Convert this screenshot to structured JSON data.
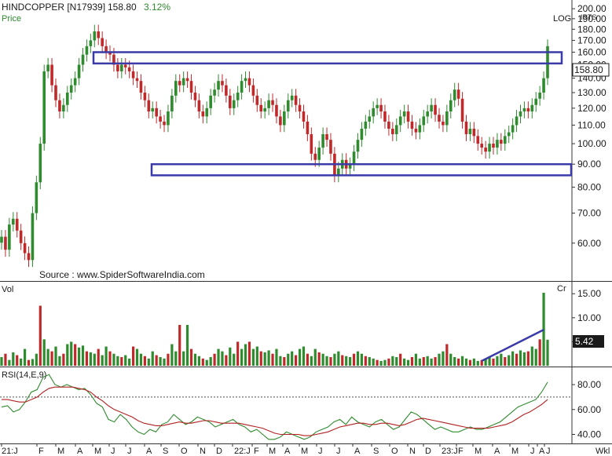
{
  "header": {
    "symbol": "HINDCOPPER [N17939]",
    "last_price": "158.80",
    "change_pct": "3.12%",
    "price_label": "Price",
    "scale_label": "LOG",
    "units_label": "IRTS",
    "source": "Source : www.SpiderSoftwareIndia.com",
    "price_tag": "158.80"
  },
  "volume": {
    "label": "Vol",
    "units": "Cr",
    "last_tag": "5.42",
    "ticks": [
      "15.00",
      "10.00",
      "5.00"
    ]
  },
  "rsi": {
    "label": "RSI(14,E,9)",
    "ticks": [
      "80.00",
      "60.00",
      "40.00"
    ]
  },
  "x_axis": {
    "labels": [
      "21:J",
      "F",
      "M",
      "A",
      "M",
      "J",
      "J",
      "A",
      "S",
      "O",
      "N",
      "D",
      "22:J",
      "F",
      "M",
      "A",
      "M",
      "J",
      "J",
      "A",
      "S",
      "O",
      "N",
      "D",
      "23:J",
      "F",
      "M",
      "A",
      "M",
      "J",
      "J",
      "A"
    ],
    "unit": "Wkl"
  },
  "colors": {
    "up": "#2e8b2e",
    "down": "#c0282a",
    "box": "#3a3aa8",
    "rsi_line": "#2e8b2e",
    "rsi_signal": "#b22222",
    "trend_line": "#3a3aa8"
  },
  "chart_data": [
    {
      "type": "candlestick",
      "title": "HINDCOPPER [N17939]",
      "scale": "log",
      "ylabel": "Price",
      "y_ticks": [
        200,
        190,
        180,
        170,
        160,
        150,
        140,
        130,
        120,
        110,
        100,
        90,
        80,
        70,
        60
      ],
      "ylim": [
        50,
        205
      ],
      "weekly_close": [
        62,
        58,
        66,
        68,
        64,
        60,
        57,
        55,
        70,
        82,
        100,
        145,
        150,
        135,
        125,
        118,
        122,
        130,
        135,
        140,
        150,
        158,
        165,
        170,
        178,
        172,
        165,
        160,
        158,
        150,
        145,
        150,
        148,
        145,
        140,
        138,
        130,
        125,
        118,
        120,
        115,
        112,
        110,
        118,
        128,
        138,
        135,
        140,
        138,
        130,
        125,
        118,
        115,
        120,
        128,
        132,
        138,
        135,
        128,
        120,
        125,
        130,
        138,
        140,
        135,
        128,
        122,
        118,
        120,
        125,
        122,
        115,
        110,
        118,
        125,
        128,
        122,
        118,
        112,
        105,
        95,
        92,
        98,
        105,
        102,
        95,
        85,
        88,
        92,
        88,
        90,
        96,
        102,
        108,
        112,
        115,
        120,
        122,
        118,
        112,
        108,
        105,
        110,
        115,
        118,
        112,
        108,
        106,
        110,
        115,
        118,
        122,
        116,
        112,
        110,
        118,
        125,
        132,
        126,
        112,
        105,
        108,
        104,
        100,
        98,
        96,
        100,
        98,
        102,
        100,
        104,
        106,
        110,
        115,
        118,
        120,
        118,
        122,
        126,
        130,
        140,
        165
      ],
      "annotations": [
        {
          "type": "box",
          "price_range": [
            151,
            160
          ]
        },
        {
          "type": "box",
          "price_range": [
            85,
            90
          ]
        }
      ]
    },
    {
      "type": "bar",
      "title": "Vol",
      "units": "Cr",
      "y_ticks": [
        15,
        10,
        5
      ],
      "values": [
        1.8,
        2.5,
        1.2,
        2.8,
        2.2,
        1.5,
        3.5,
        1.2,
        1.4,
        2.5,
        12.5,
        5.5,
        3.5,
        3.0,
        4.0,
        2.0,
        2.5,
        4.5,
        5.0,
        4.5,
        3.8,
        4.2,
        3.0,
        2.8,
        2.5,
        3.5,
        2.2,
        4.0,
        3.0,
        2.5,
        2.0,
        1.8,
        2.2,
        1.5,
        4.0,
        3.5,
        2.5,
        2.0,
        1.5,
        3.0,
        2.2,
        1.8,
        1.5,
        2.5,
        4.5,
        3.0,
        8.5,
        3.0,
        8.5,
        3.5,
        2.5,
        2.0,
        1.5,
        1.2,
        1.8,
        2.5,
        3.5,
        3.0,
        2.2,
        3.8,
        2.5,
        5.0,
        3.5,
        4.5,
        5.0,
        3.5,
        4.0,
        3.0,
        2.8,
        3.2,
        2.5,
        3.5,
        2.0,
        1.8,
        2.5,
        3.0,
        2.2,
        3.5,
        4.0,
        2.5,
        2.0,
        3.5,
        2.8,
        2.5,
        2.0,
        1.8,
        2.5,
        3.0,
        2.2,
        2.0,
        1.8,
        2.5,
        3.0,
        2.5,
        2.0,
        1.8,
        1.5,
        1.2,
        1.0,
        1.2,
        1.5,
        2.0,
        1.8,
        2.5,
        1.5,
        1.2,
        1.8,
        2.5,
        1.5,
        1.8,
        2.0,
        1.5,
        1.8,
        2.5,
        3.0,
        4.5,
        2.5,
        1.8,
        1.5,
        2.0,
        1.5,
        1.2,
        1.5,
        1.0,
        1.2,
        1.5,
        1.8,
        1.5,
        2.0,
        2.5,
        1.8,
        2.2,
        3.0,
        2.5,
        3.2,
        2.8,
        3.0,
        4.0,
        3.5,
        5.5,
        15.2,
        5.42
      ],
      "trend_line": {
        "from_index": 124,
        "to_index": 140,
        "from_value": 1.0,
        "to_value": 7.5
      }
    },
    {
      "type": "line",
      "title": "RSI(14,E,9)",
      "y_ticks": [
        80,
        60,
        40
      ],
      "ylim": [
        34,
        92
      ],
      "reference_line": 70,
      "series": [
        {
          "values": [
            62,
            63,
            58,
            60,
            66,
            74,
            76,
            86,
            88,
            80,
            78,
            80,
            78,
            76,
            77,
            72,
            65,
            62,
            52,
            50,
            56,
            52,
            46,
            42,
            40,
            44,
            42,
            48,
            50,
            56,
            52,
            48,
            50,
            54,
            52,
            50,
            46,
            48,
            50,
            52,
            48,
            46,
            42,
            44,
            40,
            36,
            36,
            38,
            42,
            40,
            38,
            36,
            38,
            42,
            44,
            46,
            50,
            52,
            48,
            54,
            50,
            48,
            46,
            50,
            52,
            48,
            44,
            46,
            52,
            58,
            56,
            52,
            48,
            44,
            46,
            44,
            42,
            42,
            44,
            46,
            44,
            44,
            46,
            48,
            50,
            54,
            58,
            62,
            64,
            66,
            68,
            74,
            82
          ]
        },
        {
          "values": [
            68,
            68,
            67,
            66,
            66,
            68,
            70,
            74,
            77,
            78,
            78,
            78,
            78,
            77,
            76,
            74,
            70,
            67,
            63,
            60,
            58,
            56,
            54,
            51,
            49,
            48,
            47,
            47,
            48,
            49,
            50,
            49,
            49,
            50,
            51,
            51,
            50,
            49,
            49,
            49,
            49,
            48,
            47,
            46,
            45,
            43,
            41,
            40,
            40,
            40,
            40,
            39,
            39,
            40,
            41,
            42,
            44,
            46,
            47,
            48,
            49,
            49,
            48,
            48,
            49,
            49,
            48,
            47,
            48,
            50,
            52,
            53,
            52,
            51,
            50,
            49,
            48,
            47,
            46,
            45,
            45,
            45,
            45,
            46,
            47,
            48,
            50,
            53,
            56,
            58,
            61,
            64,
            68
          ]
        }
      ]
    }
  ]
}
